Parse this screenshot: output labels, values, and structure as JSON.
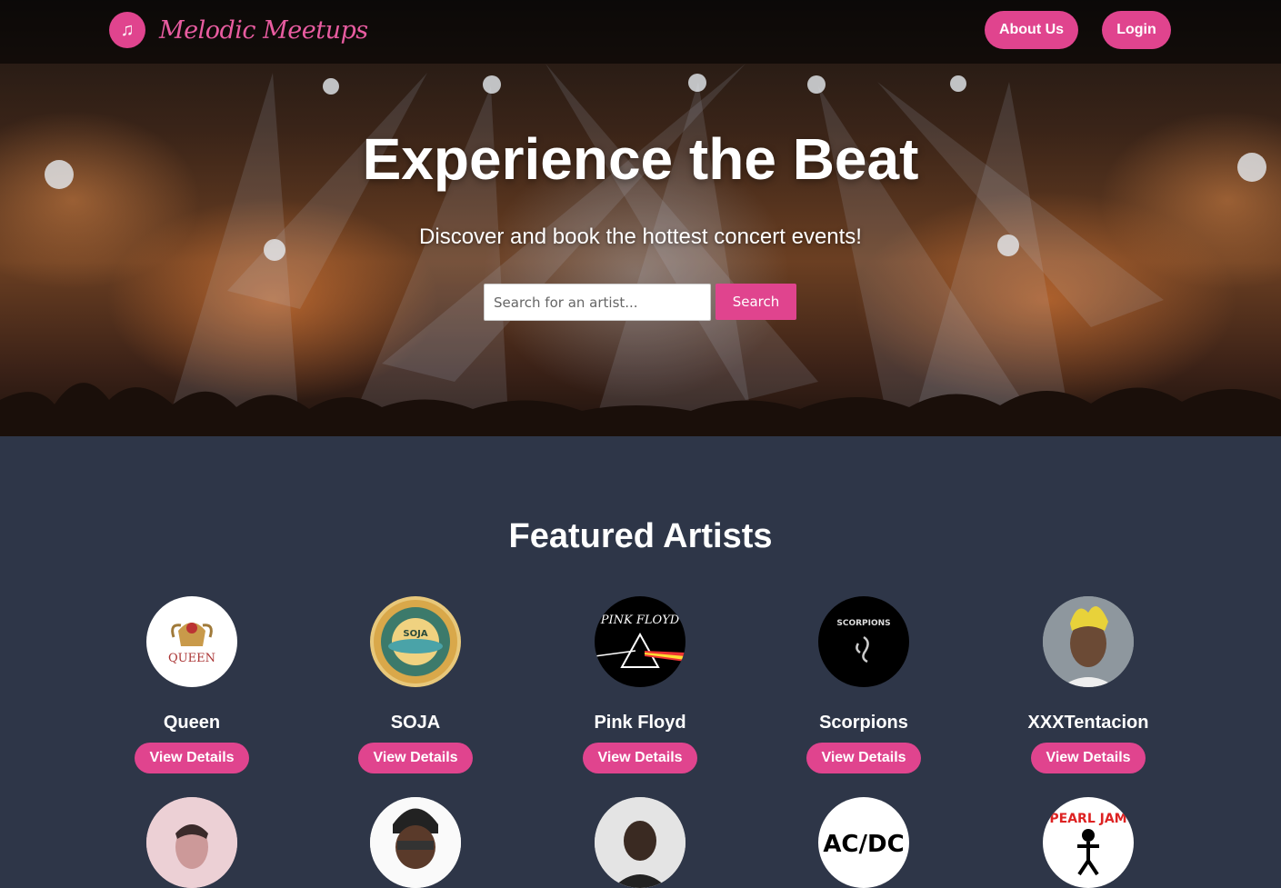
{
  "brand": {
    "name": "Melodic Meetups",
    "icon": "music-note-icon"
  },
  "nav": {
    "about_label": "About Us",
    "login_label": "Login"
  },
  "hero": {
    "title": "Experience the Beat",
    "subtitle": "Discover and book the hottest concert events!",
    "search_placeholder": "Search for an artist...",
    "search_button": "Search"
  },
  "featured": {
    "title": "Featured Artists",
    "details_label": "View Details",
    "artists": [
      {
        "name": "Queen"
      },
      {
        "name": "SOJA"
      },
      {
        "name": "Pink Floyd"
      },
      {
        "name": "Scorpions"
      },
      {
        "name": "XXXTentacion"
      }
    ],
    "second_row_logos": {
      "acdc": "AC/DC",
      "pearljam": "PEARL JAM",
      "queen_logo": "QUEEN",
      "soja_logo": "SOJA",
      "pinkfloyd_logo": "PINK FLOYD",
      "scorpions_logo": "SCORPIONS"
    }
  },
  "colors": {
    "accent": "#e0448e",
    "background": "#2e3648"
  }
}
